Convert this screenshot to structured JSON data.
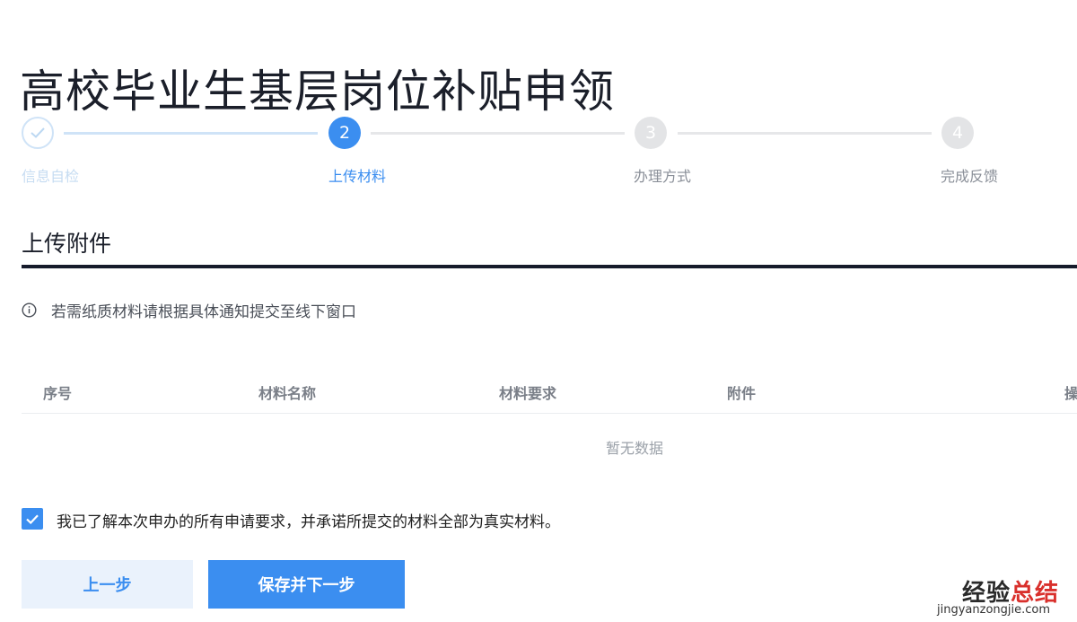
{
  "title": "高校毕业生基层岗位补贴申领",
  "steps": [
    {
      "label": "信息自检",
      "status": "done"
    },
    {
      "label": "上传材料",
      "number": "2",
      "status": "active"
    },
    {
      "label": "办理方式",
      "number": "3",
      "status": "todo"
    },
    {
      "label": "完成反馈",
      "number": "4",
      "status": "todo"
    }
  ],
  "section": {
    "title": "上传附件",
    "notice": "若需纸质材料请根据具体通知提交至线下窗口"
  },
  "table": {
    "headers": [
      "序号",
      "材料名称",
      "材料要求",
      "附件",
      "操"
    ],
    "empty_text": "暂无数据"
  },
  "agreement": {
    "checked": true,
    "text": "我已了解本次申办的所有申请要求，并承诺所提交的材料全部为真实材料。"
  },
  "buttons": {
    "prev": "上一步",
    "next": "保存并下一步"
  },
  "watermark": {
    "text_a": "经验",
    "text_b": "总结",
    "url": "jingyanzongjie.com"
  },
  "colors": {
    "accent": "#3b8ef0",
    "done": "#cfe3f7",
    "todo": "#e3e4e6",
    "text": "#1b1f2a"
  }
}
